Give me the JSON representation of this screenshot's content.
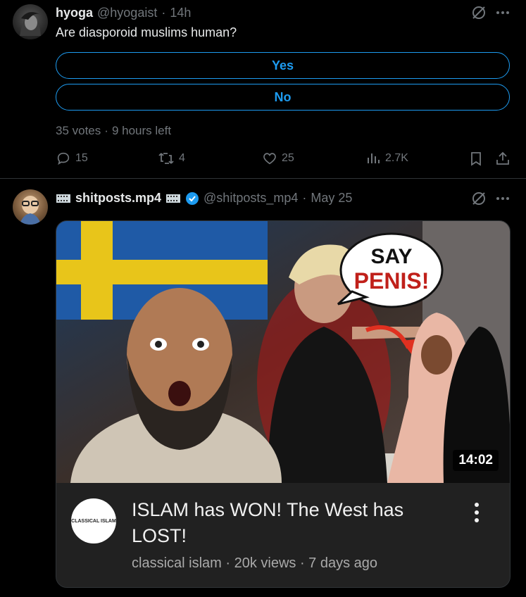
{
  "post1": {
    "display_name": "hyoga",
    "handle": "@hyogaist",
    "separator": "·",
    "time": "14h",
    "text": "Are diasporoid muslims human?",
    "poll": {
      "options": [
        "Yes",
        "No"
      ],
      "votes": "35 votes",
      "time_left": "9 hours left",
      "separator": "·"
    },
    "actions": {
      "replies": "15",
      "reposts": "4",
      "likes": "25",
      "views": "2.7K"
    }
  },
  "post2": {
    "display_name": "shitposts.mp4",
    "handle": "@shitposts_mp4",
    "separator": "·",
    "time": "May 25",
    "video": {
      "duration": "14:02",
      "speech_bubble_line1": "SAY",
      "speech_bubble_line2": "PENIS!",
      "title": "ISLAM has WON! The West has LOST!",
      "channel_logo_text": "CLASSICAL ISLAM",
      "meta": "classical islam · 20k views · 7 days ago"
    }
  },
  "colors": {
    "accent": "#1d9bf0",
    "muted": "#71767b",
    "text": "#e7e9ea",
    "verified": "#1d9bf0"
  }
}
